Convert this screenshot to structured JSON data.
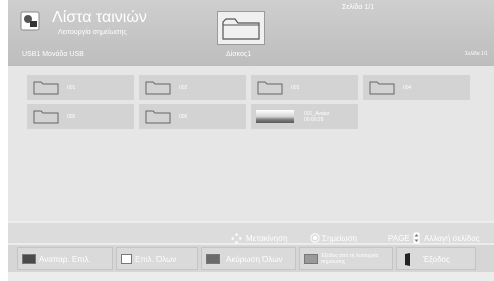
{
  "header": {
    "title": "Λίστα ταινιών",
    "mode": "Λειτουργία σημείωσης",
    "usb": "USB1   Μονάδα USB",
    "page_top": "Σελίδα 1/1",
    "page_right": "Σελίδα 1/1",
    "disk": "Δίσκος1",
    "icons": [
      "movie-icon",
      "folder-icon"
    ]
  },
  "items": [
    {
      "label": "001",
      "type": "folder"
    },
    {
      "label": "002",
      "type": "folder"
    },
    {
      "label": "003",
      "type": "folder"
    },
    {
      "label": "004",
      "type": "folder"
    },
    {
      "label": "005",
      "type": "folder"
    },
    {
      "label": "006",
      "type": "folder"
    },
    {
      "label": "001_Avatar",
      "type": "video",
      "sub": "00:00:29"
    }
  ],
  "hints": {
    "move": "Μετακίνηση",
    "mark": "Σημείωση",
    "page_key": "PAGE",
    "page_change": "Αλλαγή σελίδας"
  },
  "buttons": [
    {
      "label": "Αναπαρ. Επιλ.",
      "color": "#4a4a4a"
    },
    {
      "label": "Επιλ. Όλων",
      "color": "#ffffff"
    },
    {
      "label": "Ακύρωση Όλων",
      "color": "#6a6a6a"
    },
    {
      "label": "Έξοδος από τη λειτουργία σημείωσης",
      "color": "#9a9a9a"
    },
    {
      "label": "Έξοδος",
      "color": "#222222"
    }
  ]
}
